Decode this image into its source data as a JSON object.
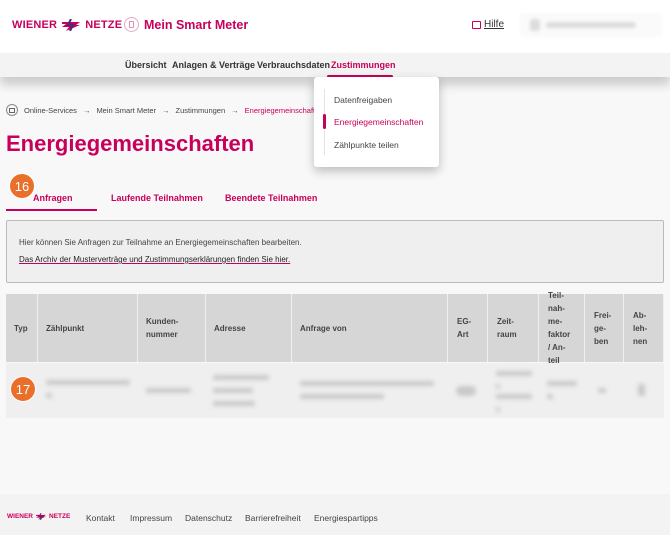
{
  "header": {
    "logo_left": "WIENER",
    "logo_right": "NETZE",
    "app_title": "Mein Smart Meter",
    "help_label": "Hilfe"
  },
  "nav": {
    "items": [
      {
        "label": "Übersicht"
      },
      {
        "label": "Anlagen & Verträge"
      },
      {
        "label": "Verbrauchsdaten"
      },
      {
        "label": "Zustimmungen",
        "active": true
      }
    ],
    "dropdown": [
      {
        "label": "Datenfreigaben"
      },
      {
        "label": "Energiegemeinschaften",
        "active": true
      },
      {
        "label": "Zählpunkte teilen"
      }
    ]
  },
  "breadcrumb": [
    "Online-Services",
    "Mein Smart Meter",
    "Zustimmungen",
    "Energiegemeinschaften"
  ],
  "page_title": "Energiegemeinschaften",
  "tabs": [
    {
      "label": "Anfragen",
      "active": true
    },
    {
      "label": "Laufende Teilnahmen"
    },
    {
      "label": "Beendete Teilnahmen"
    }
  ],
  "badges": {
    "tabs": "16",
    "row": "17"
  },
  "info": {
    "text": "Hier können Sie Anfragen zur Teilnahme an Energiegemeinschaften bearbeiten.",
    "link": "Das Archiv der Musterverträge und Zustimmungserklärungen finden Sie hier."
  },
  "table": {
    "columns": [
      "Typ",
      "Zählpunkt",
      "Kunden-\nnummer",
      "Adresse",
      "Anfrage von",
      "EG-\nArt",
      "Zeit-\nraum",
      "Teil-\nnah-\nme-\nfaktor\n/ An-\nteil",
      "Frei-\nge-\nben",
      "Ab-\nleh-\nnen"
    ]
  },
  "footer": {
    "logo_left": "WIENER",
    "logo_right": "NETZE",
    "links": [
      "Kontakt",
      "Impressum",
      "Datenschutz",
      "Barrierefreiheit",
      "Energiespartipps"
    ]
  },
  "colors": {
    "brand": "#c8005a",
    "badge": "#e8702a"
  }
}
